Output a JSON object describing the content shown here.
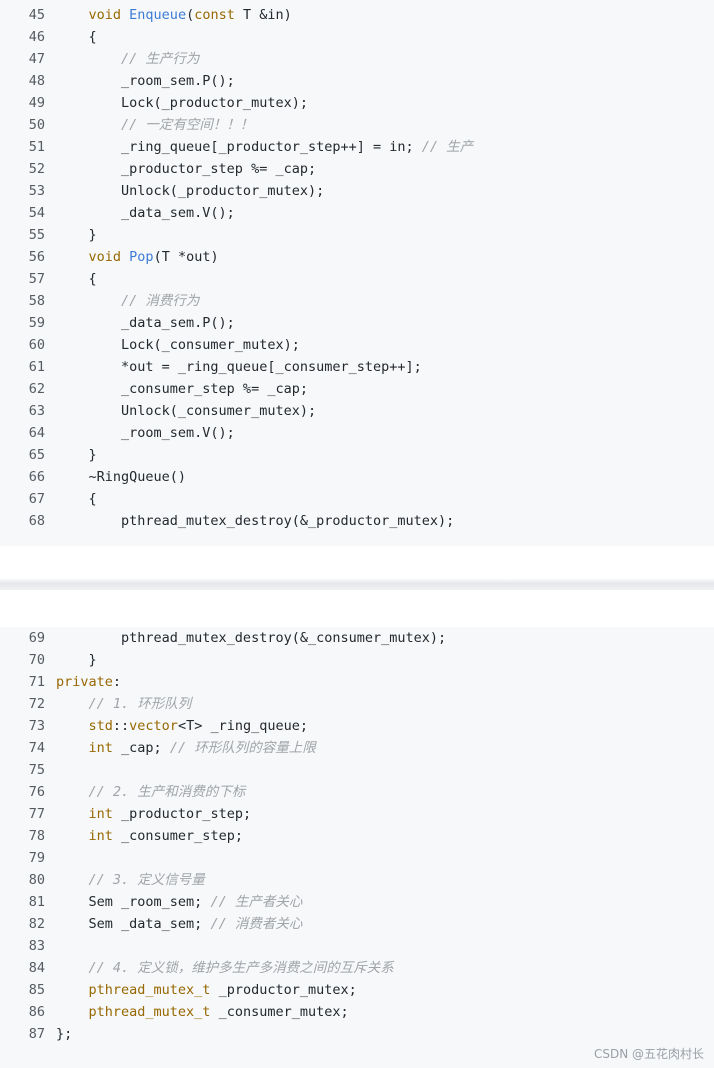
{
  "block1": [
    {
      "n": "45",
      "c": "    void Enqueue(const T &in)"
    },
    {
      "n": "46",
      "c": "    {"
    },
    {
      "n": "47",
      "c": "        // 生产行为"
    },
    {
      "n": "48",
      "c": "        _room_sem.P();"
    },
    {
      "n": "49",
      "c": "        Lock(_productor_mutex);"
    },
    {
      "n": "50",
      "c": "        // 一定有空间！！！"
    },
    {
      "n": "51",
      "c": "        _ring_queue[_productor_step++] = in; // 生产"
    },
    {
      "n": "52",
      "c": "        _productor_step %= _cap;"
    },
    {
      "n": "53",
      "c": "        Unlock(_productor_mutex);"
    },
    {
      "n": "54",
      "c": "        _data_sem.V();"
    },
    {
      "n": "55",
      "c": "    }"
    },
    {
      "n": "56",
      "c": "    void Pop(T *out)"
    },
    {
      "n": "57",
      "c": "    {"
    },
    {
      "n": "58",
      "c": "        // 消费行为"
    },
    {
      "n": "59",
      "c": "        _data_sem.P();"
    },
    {
      "n": "60",
      "c": "        Lock(_consumer_mutex);"
    },
    {
      "n": "61",
      "c": "        *out = _ring_queue[_consumer_step++];"
    },
    {
      "n": "62",
      "c": "        _consumer_step %= _cap;"
    },
    {
      "n": "63",
      "c": "        Unlock(_consumer_mutex);"
    },
    {
      "n": "64",
      "c": "        _room_sem.V();"
    },
    {
      "n": "65",
      "c": "    }"
    },
    {
      "n": "66",
      "c": "    ~RingQueue()"
    },
    {
      "n": "67",
      "c": "    {"
    },
    {
      "n": "68",
      "c": "        pthread_mutex_destroy(&_productor_mutex);"
    }
  ],
  "block2": [
    {
      "n": "69",
      "c": "        pthread_mutex_destroy(&_consumer_mutex);"
    },
    {
      "n": "70",
      "c": "    }"
    },
    {
      "n": "71",
      "c": "private:"
    },
    {
      "n": "72",
      "c": "    // 1. 环形队列"
    },
    {
      "n": "73",
      "c": "    std::vector<T> _ring_queue;"
    },
    {
      "n": "74",
      "c": "    int _cap; // 环形队列的容量上限"
    },
    {
      "n": "75",
      "c": ""
    },
    {
      "n": "76",
      "c": "    // 2. 生产和消费的下标"
    },
    {
      "n": "77",
      "c": "    int _productor_step;"
    },
    {
      "n": "78",
      "c": "    int _consumer_step;"
    },
    {
      "n": "79",
      "c": ""
    },
    {
      "n": "80",
      "c": "    // 3. 定义信号量"
    },
    {
      "n": "81",
      "c": "    Sem _room_sem; // 生产者关心"
    },
    {
      "n": "82",
      "c": "    Sem _data_sem; // 消费者关心"
    },
    {
      "n": "83",
      "c": ""
    },
    {
      "n": "84",
      "c": "    // 4. 定义锁，维护多生产多消费之间的互斥关系"
    },
    {
      "n": "85",
      "c": "    pthread_mutex_t _productor_mutex;"
    },
    {
      "n": "86",
      "c": "    pthread_mutex_t _consumer_mutex;"
    },
    {
      "n": "87",
      "c": "};"
    }
  ],
  "watermark": "CSDN @五花肉村长",
  "colors": {
    "background": "#f6f8fa",
    "keyword": "#986801",
    "function": "#3c7bd6",
    "comment": "#a0a4a8",
    "text": "#24292e",
    "line_number": "#555b61"
  }
}
